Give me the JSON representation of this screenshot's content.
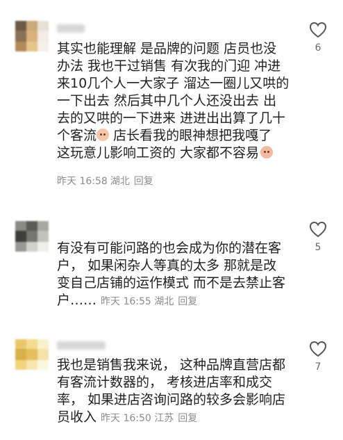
{
  "comments": [
    {
      "lines": [
        "其实也能理解 是品牌的问题 店员也没",
        "办法 我也干过销售 有次我的门迎 冲进",
        "来10几个人一大家子 溜达一圈儿又哄的",
        "一下出去 然后其中几个人还没出去 出",
        "去的又哄的一下进来 进进出出算了几十",
        "个客流",
        "店长看我的眼神想把我嘎了",
        "这玩意儿影响工资的 大家都不容易"
      ],
      "time": "昨天 16:58",
      "location": "湖北",
      "reply": "回复",
      "likes": "6",
      "emoji_1": "emoji-face-icon",
      "emoji_2": "emoji-crying-icon"
    },
    {
      "lines": [
        "有没有可能问路的也会成为你的潜在客",
        "户， 如果闲杂人等真的太多 那就是改",
        "变自己店铺的运作模式 而不是去禁止客",
        "户……"
      ],
      "time": "昨天 16:55",
      "location": "湖北",
      "reply": "回复",
      "likes": "5"
    },
    {
      "lines": [
        "我也是销售我来说， 这种品牌直营店都",
        "有客流计数器的， 考核进店率和成交",
        "率， 如果进店咨询问路的较多会影响店",
        "员收入"
      ],
      "time": "昨天 16:50",
      "location": "江苏",
      "reply": "回复",
      "likes": "7"
    }
  ],
  "icons": {
    "like": "heart-outline-icon"
  },
  "colors": {
    "meta": "#8c8c8c",
    "text": "#1f1f1f",
    "heart": "#555555"
  }
}
